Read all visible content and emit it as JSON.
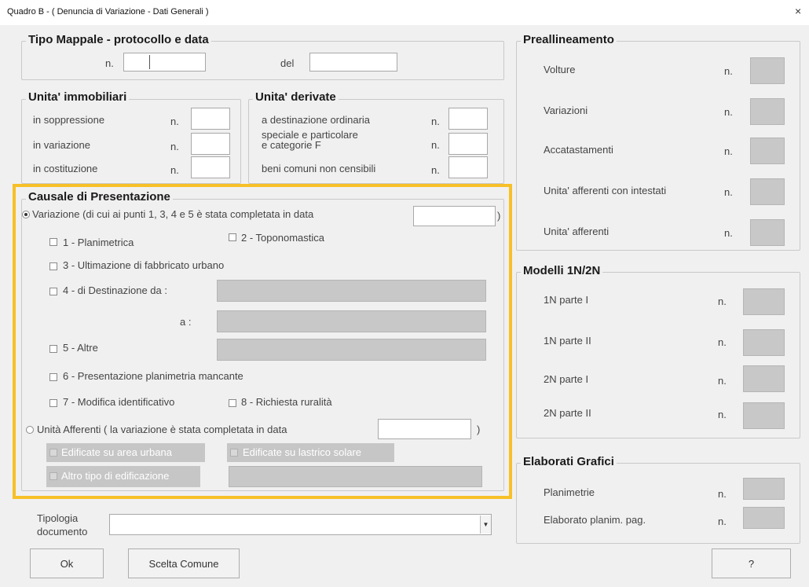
{
  "window": {
    "title": "Quadro B - ( Denuncia di Variazione - Dati Generali )",
    "close_glyph": "×"
  },
  "tipo_mappale": {
    "legend": "Tipo Mappale - protocollo e data",
    "n_label": "n.",
    "del_label": "del",
    "n_value": "",
    "del_value": ""
  },
  "unita_immobiliari": {
    "legend": "Unita' immobiliari",
    "rows": [
      {
        "label": "in soppressione",
        "n": "n.",
        "value": ""
      },
      {
        "label": "in variazione",
        "n": "n.",
        "value": ""
      },
      {
        "label": "in costituzione",
        "n": "n.",
        "value": ""
      }
    ]
  },
  "unita_derivate": {
    "legend": "Unita' derivate",
    "rows": [
      {
        "label": "a destinazione ordinaria",
        "n": "n.",
        "value": ""
      },
      {
        "label_line1": "speciale e particolare",
        "label_line2": "e categorie F",
        "n": "n.",
        "value": ""
      },
      {
        "label": "beni comuni non censibili",
        "n": "n.",
        "value": ""
      }
    ]
  },
  "causale": {
    "legend": "Causale di Presentazione",
    "variazione_label": "Variazione (di cui ai punti 1, 3, 4 e 5 è stata completata in data",
    "variazione_date": "",
    "paren_close": ")",
    "opt1": "1 - Planimetrica",
    "opt2": "2 - Toponomastica",
    "opt3": "3 - Ultimazione di fabbricato urbano",
    "opt4": "4 - di Destinazione da :",
    "opt4_a": "a :",
    "opt5": "5 - Altre",
    "opt6": "6 - Presentazione planimetria mancante",
    "opt7": "7 - Modifica identificativo",
    "opt8": "8 - Richiesta ruralità",
    "afferenti_label": "Unità Afferenti ( la variazione è stata completata in data",
    "afferenti_date": "",
    "dis1": "Edificate su area urbana",
    "dis2": "Edificate su lastrico solare",
    "dis3": "Altro tipo di edificazione"
  },
  "tipologia": {
    "label_line1": "Tipologia",
    "label_line2": "documento",
    "value": "",
    "arrow": "▼"
  },
  "buttons": {
    "ok": "Ok",
    "scelta": "Scelta Comune",
    "help": "?"
  },
  "preallineamento": {
    "legend": "Preallineamento",
    "rows": [
      {
        "label": "Volture",
        "n": "n."
      },
      {
        "label": "Variazioni",
        "n": "n."
      },
      {
        "label": "Accatastamenti",
        "n": "n."
      },
      {
        "label": "Unita' afferenti con intestati",
        "n": "n."
      },
      {
        "label": "Unita' afferenti",
        "n": "n."
      }
    ]
  },
  "modelli": {
    "legend": "Modelli 1N/2N",
    "rows": [
      {
        "label": "1N parte I",
        "n": "n."
      },
      {
        "label": "1N parte II",
        "n": "n."
      },
      {
        "label": "2N parte I",
        "n": "n."
      },
      {
        "label": "2N parte II",
        "n": "n."
      }
    ]
  },
  "elaborati": {
    "legend": "Elaborati Grafici",
    "rows": [
      {
        "label": "Planimetrie",
        "n": "n."
      },
      {
        "label": "Elaborato planim. pag.",
        "n": "n."
      }
    ]
  },
  "colors": {
    "highlight": "#f7c027",
    "window_bg": "#f0f0f0",
    "disabled_fill": "#c8c8c8"
  }
}
